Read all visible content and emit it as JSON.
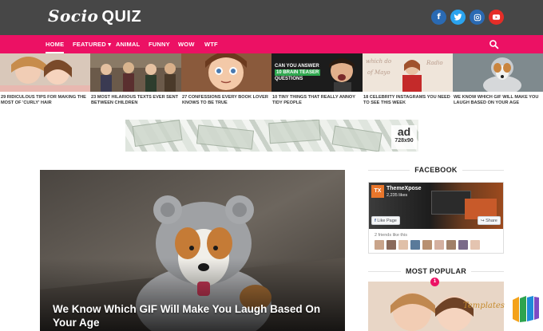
{
  "site": {
    "logo_script": "Socio",
    "logo_bold": "QUIZ"
  },
  "social": [
    {
      "name": "facebook",
      "glyph": "f",
      "color": "#2a6ab3"
    },
    {
      "name": "twitter",
      "glyph": "t",
      "color": "#2aa3ef"
    },
    {
      "name": "instagram",
      "glyph": "◎",
      "color": "#2a6ab3"
    },
    {
      "name": "youtube",
      "glyph": "▶",
      "color": "#e52d27"
    }
  ],
  "nav": {
    "home": "HOME",
    "featured": "FEATURED",
    "featured_caret": "▾",
    "animal": "ANIMAL",
    "funny": "FUNNY",
    "wow": "WOW",
    "wtf": "WTF"
  },
  "featured": [
    {
      "caption": "29 RIDICULOUS TIPS FOR MAKING THE MOST OF 'CURLY' HAIR"
    },
    {
      "caption": "23 MOST HILARIOUS TEXTS EVER SENT BETWEEN CHILDREN"
    },
    {
      "caption": "27 CONFESSIONS EVERY BOOK LOVER KNOWS TO BE TRUE"
    },
    {
      "caption": "10 TINY THINGS THAT REALLY ANNOY TIDY PEOPLE",
      "overlay_top": "CAN YOU ANSWER",
      "overlay_mid": "10 BRAIN TEASER",
      "overlay_bot": "QUESTIONS"
    },
    {
      "caption": "18 CELEBRITY INSTAGRAMS YOU NEED TO SEE THIS WEEK"
    },
    {
      "caption": "WE KNOW WHICH GIF WILL MAKE YOU LAUGH BASED ON YOUR AGE"
    }
  ],
  "ad": {
    "label": "ad",
    "size": "728x90"
  },
  "main_post": {
    "title": "We Know Which GIF Will Make You Laugh Based On Your Age"
  },
  "sidebar": {
    "facebook_title": "FACEBOOK",
    "fb_page_name": "ThemeXpose",
    "fb_likes": "2,235 likes",
    "fb_like_button": "Like Page",
    "fb_share_button": "Share",
    "fb_friends_text": "2 friends like this",
    "most_popular_title": "MOST POPULAR",
    "popular_badge": "1",
    "watermark": "Templates"
  },
  "colors": {
    "header_bg": "#474747",
    "nav_bg": "#ec1164",
    "accent": "#ec1164"
  }
}
